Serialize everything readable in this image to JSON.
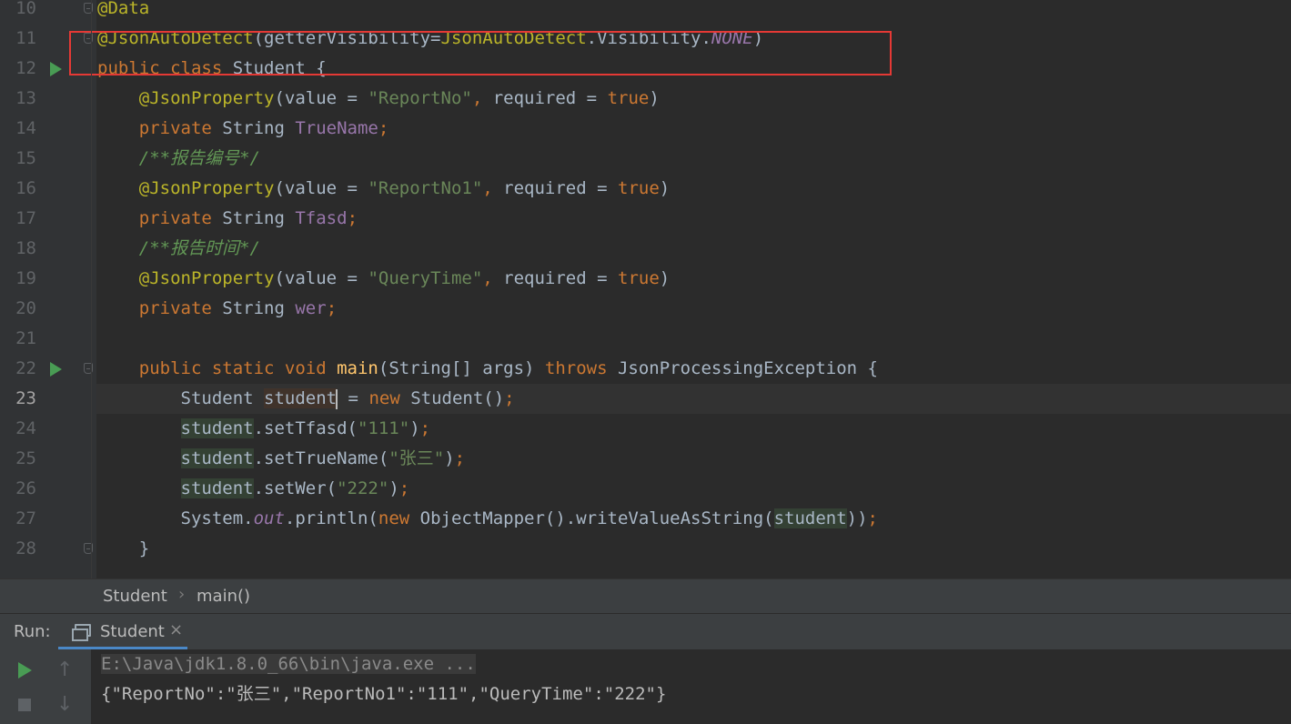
{
  "editor": {
    "lines": [
      {
        "num": "10",
        "tokens": [
          [
            "ann",
            "@Data"
          ]
        ]
      },
      {
        "num": "11",
        "tokens": [
          [
            "ann",
            "@JsonAutoDetect"
          ],
          [
            "plain",
            "(getterVisibility="
          ],
          [
            "ann",
            "JsonAutoDetect"
          ],
          [
            "plain",
            ".Visibility."
          ],
          [
            "sfld",
            "NONE"
          ],
          [
            "plain",
            ")"
          ]
        ]
      },
      {
        "num": "12",
        "tokens": [
          [
            "kw",
            "public class "
          ],
          [
            "plain",
            "Student {"
          ]
        ]
      },
      {
        "num": "13",
        "tokens": [
          [
            "plain",
            "    "
          ],
          [
            "ann",
            "@JsonProperty"
          ],
          [
            "plain",
            "(value = "
          ],
          [
            "str",
            "\"ReportNo\""
          ],
          [
            "kw",
            ", "
          ],
          [
            "plain",
            "required = "
          ],
          [
            "kw",
            "true"
          ],
          [
            "plain",
            ")"
          ]
        ]
      },
      {
        "num": "14",
        "tokens": [
          [
            "plain",
            "    "
          ],
          [
            "kw",
            "private "
          ],
          [
            "plain",
            "String "
          ],
          [
            "fld",
            "TrueName"
          ],
          [
            "kw",
            ";"
          ]
        ]
      },
      {
        "num": "15",
        "tokens": [
          [
            "plain",
            "    "
          ],
          [
            "cmt",
            "/**报告编号*/"
          ]
        ]
      },
      {
        "num": "16",
        "tokens": [
          [
            "plain",
            "    "
          ],
          [
            "ann",
            "@JsonProperty"
          ],
          [
            "plain",
            "(value = "
          ],
          [
            "str",
            "\"ReportNo1\""
          ],
          [
            "kw",
            ", "
          ],
          [
            "plain",
            "required = "
          ],
          [
            "kw",
            "true"
          ],
          [
            "plain",
            ")"
          ]
        ]
      },
      {
        "num": "17",
        "tokens": [
          [
            "plain",
            "    "
          ],
          [
            "kw",
            "private "
          ],
          [
            "plain",
            "String "
          ],
          [
            "fld",
            "Tfasd"
          ],
          [
            "kw",
            ";"
          ]
        ]
      },
      {
        "num": "18",
        "tokens": [
          [
            "plain",
            "    "
          ],
          [
            "cmt",
            "/**报告时间*/"
          ]
        ]
      },
      {
        "num": "19",
        "tokens": [
          [
            "plain",
            "    "
          ],
          [
            "ann",
            "@JsonProperty"
          ],
          [
            "plain",
            "(value = "
          ],
          [
            "str",
            "\"QueryTime\""
          ],
          [
            "kw",
            ", "
          ],
          [
            "plain",
            "required = "
          ],
          [
            "kw",
            "true"
          ],
          [
            "plain",
            ")"
          ]
        ]
      },
      {
        "num": "20",
        "tokens": [
          [
            "plain",
            "    "
          ],
          [
            "kw",
            "private "
          ],
          [
            "plain",
            "String "
          ],
          [
            "fld",
            "wer"
          ],
          [
            "kw",
            ";"
          ]
        ]
      },
      {
        "num": "21",
        "tokens": []
      },
      {
        "num": "22",
        "tokens": [
          [
            "plain",
            "    "
          ],
          [
            "kw",
            "public static void "
          ],
          [
            "fn",
            "main"
          ],
          [
            "plain",
            "(String[] args) "
          ],
          [
            "kw",
            "throws "
          ],
          [
            "plain",
            "JsonProcessingException {"
          ]
        ]
      },
      {
        "num": "23",
        "tokens": [
          [
            "plain",
            "        Student "
          ],
          [
            "var-decl",
            "student"
          ],
          [
            "caret",
            ""
          ],
          [
            "plain",
            " = "
          ],
          [
            "kw",
            "new "
          ],
          [
            "plain",
            "Student()"
          ],
          [
            "kw",
            ";"
          ]
        ]
      },
      {
        "num": "24",
        "tokens": [
          [
            "plain",
            "        "
          ],
          [
            "var-hl",
            "student"
          ],
          [
            "plain",
            ".setTfasd("
          ],
          [
            "str",
            "\"111\""
          ],
          [
            "plain",
            ")"
          ],
          [
            "kw",
            ";"
          ]
        ]
      },
      {
        "num": "25",
        "tokens": [
          [
            "plain",
            "        "
          ],
          [
            "var-hl",
            "student"
          ],
          [
            "plain",
            ".setTrueName("
          ],
          [
            "str",
            "\"张三\""
          ],
          [
            "plain",
            ")"
          ],
          [
            "kw",
            ";"
          ]
        ]
      },
      {
        "num": "26",
        "tokens": [
          [
            "plain",
            "        "
          ],
          [
            "var-hl",
            "student"
          ],
          [
            "plain",
            ".setWer("
          ],
          [
            "str",
            "\"222\""
          ],
          [
            "plain",
            ")"
          ],
          [
            "kw",
            ";"
          ]
        ]
      },
      {
        "num": "27",
        "tokens": [
          [
            "plain",
            "        System."
          ],
          [
            "sfld",
            "out"
          ],
          [
            "plain",
            ".println("
          ],
          [
            "kw",
            "new "
          ],
          [
            "plain",
            "ObjectMapper().writeValueAsString("
          ],
          [
            "var-hl",
            "student"
          ],
          [
            "plain",
            "))"
          ],
          [
            "kw",
            ";"
          ]
        ]
      },
      {
        "num": "28",
        "tokens": [
          [
            "plain",
            "    }"
          ]
        ]
      }
    ],
    "current_line": "23"
  },
  "breadcrumb": {
    "items": [
      "Student",
      "main()"
    ]
  },
  "run_panel": {
    "label": "Run:",
    "tab_label": "Student",
    "close": "×"
  },
  "console": {
    "lines": [
      "E:\\Java\\jdk1.8.0_66\\bin\\java.exe ...",
      "{\"ReportNo\":\"张三\",\"ReportNo1\":\"111\",\"QueryTime\":\"222\"}"
    ]
  },
  "icons": {
    "run": "run-icon",
    "fold": "fold-icon",
    "stop": "stop-icon",
    "up": "arrow-up-icon",
    "down": "arrow-down-icon",
    "console_tab": "console-icon"
  },
  "colors": {
    "highlight_box": "#e53935",
    "keyword": "#cc7832",
    "annotation": "#bbb529",
    "string": "#6a8759",
    "field": "#9876aa",
    "comment": "#629755",
    "method": "#ffc66d"
  }
}
